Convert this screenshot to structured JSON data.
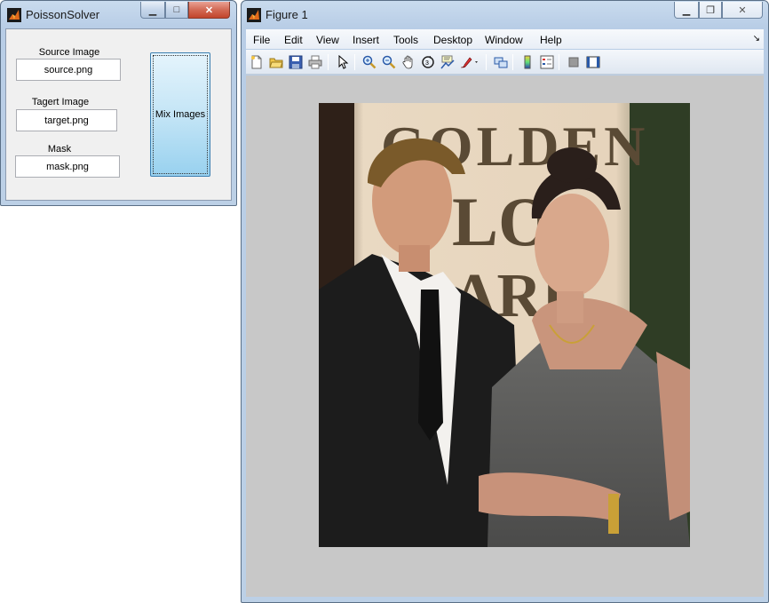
{
  "poisson": {
    "title": "PoissonSolver",
    "source_label": "Source Image",
    "source_value": "source.png",
    "target_label": "Tagert Image",
    "target_value": "target.png",
    "mask_label": "Mask",
    "mask_value": "mask.png",
    "mix_button": "Mix Images"
  },
  "figure": {
    "title": "Figure 1",
    "menu": [
      "File",
      "Edit",
      "View",
      "Insert",
      "Tools",
      "Desktop",
      "Window",
      "Help"
    ],
    "toolbar_icons": [
      "new-figure-icon",
      "open-file-icon",
      "save-icon",
      "print-icon",
      "edit-plot-arrow-icon",
      "zoom-in-icon",
      "zoom-out-icon",
      "pan-hand-icon",
      "rotate-3d-icon",
      "data-cursor-icon",
      "brush-icon",
      "link-plot-icon",
      "colorbar-icon",
      "legend-icon",
      "hide-plot-tools-icon",
      "show-plot-tools-icon"
    ],
    "image_content": "red-carpet-photo-couple"
  },
  "colors": {
    "titlebar": "#c9dbee",
    "canvas_bg": "#c8c8c8",
    "button_blue": "#c4e5f6",
    "close_red": "#c2452c"
  }
}
